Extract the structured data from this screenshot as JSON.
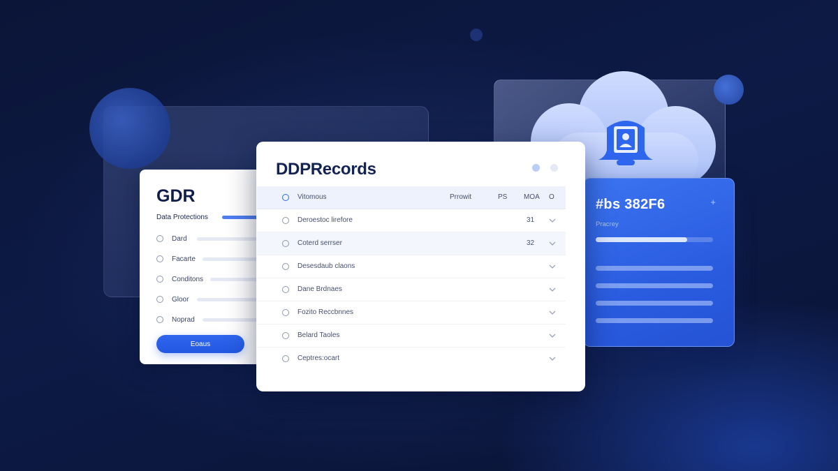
{
  "colors": {
    "background": "#0b1538",
    "accent": "#2F66EE",
    "card_blue": "#3C74F0",
    "white": "#FFFFFF"
  },
  "gdr_card": {
    "title": "GDR",
    "subtitle": "Data Protections",
    "options": [
      "Dard",
      "Facarte",
      "Conditons",
      "Gloor",
      "Noprad"
    ],
    "button_label": "Eoaus"
  },
  "records_card": {
    "title": "DDPRecords",
    "header": {
      "name": "Vitomous",
      "col1": "Prrowit",
      "col2": "PS",
      "col3": "MOA",
      "col4": "O"
    },
    "rows": [
      {
        "name": "Deroestoc lirefore",
        "value": "31"
      },
      {
        "name": "Coterd serrser",
        "value": "32"
      },
      {
        "name": "Desesdaub claons",
        "value": ""
      },
      {
        "name": "Dane Brdnaes",
        "value": ""
      },
      {
        "name": "Fozito Reccbnnes",
        "value": ""
      },
      {
        "name": "Belard Taoles",
        "value": ""
      },
      {
        "name": "Ceptres:ocart",
        "value": ""
      }
    ]
  },
  "color_card": {
    "title": "#bs 382F6",
    "plus": "+",
    "subtitle": "Pracrey",
    "progress": 0.78
  },
  "icons": {
    "cloud": "cloud-icon",
    "lock": "lock-user-icon",
    "chevron": "chevron-down-icon"
  }
}
